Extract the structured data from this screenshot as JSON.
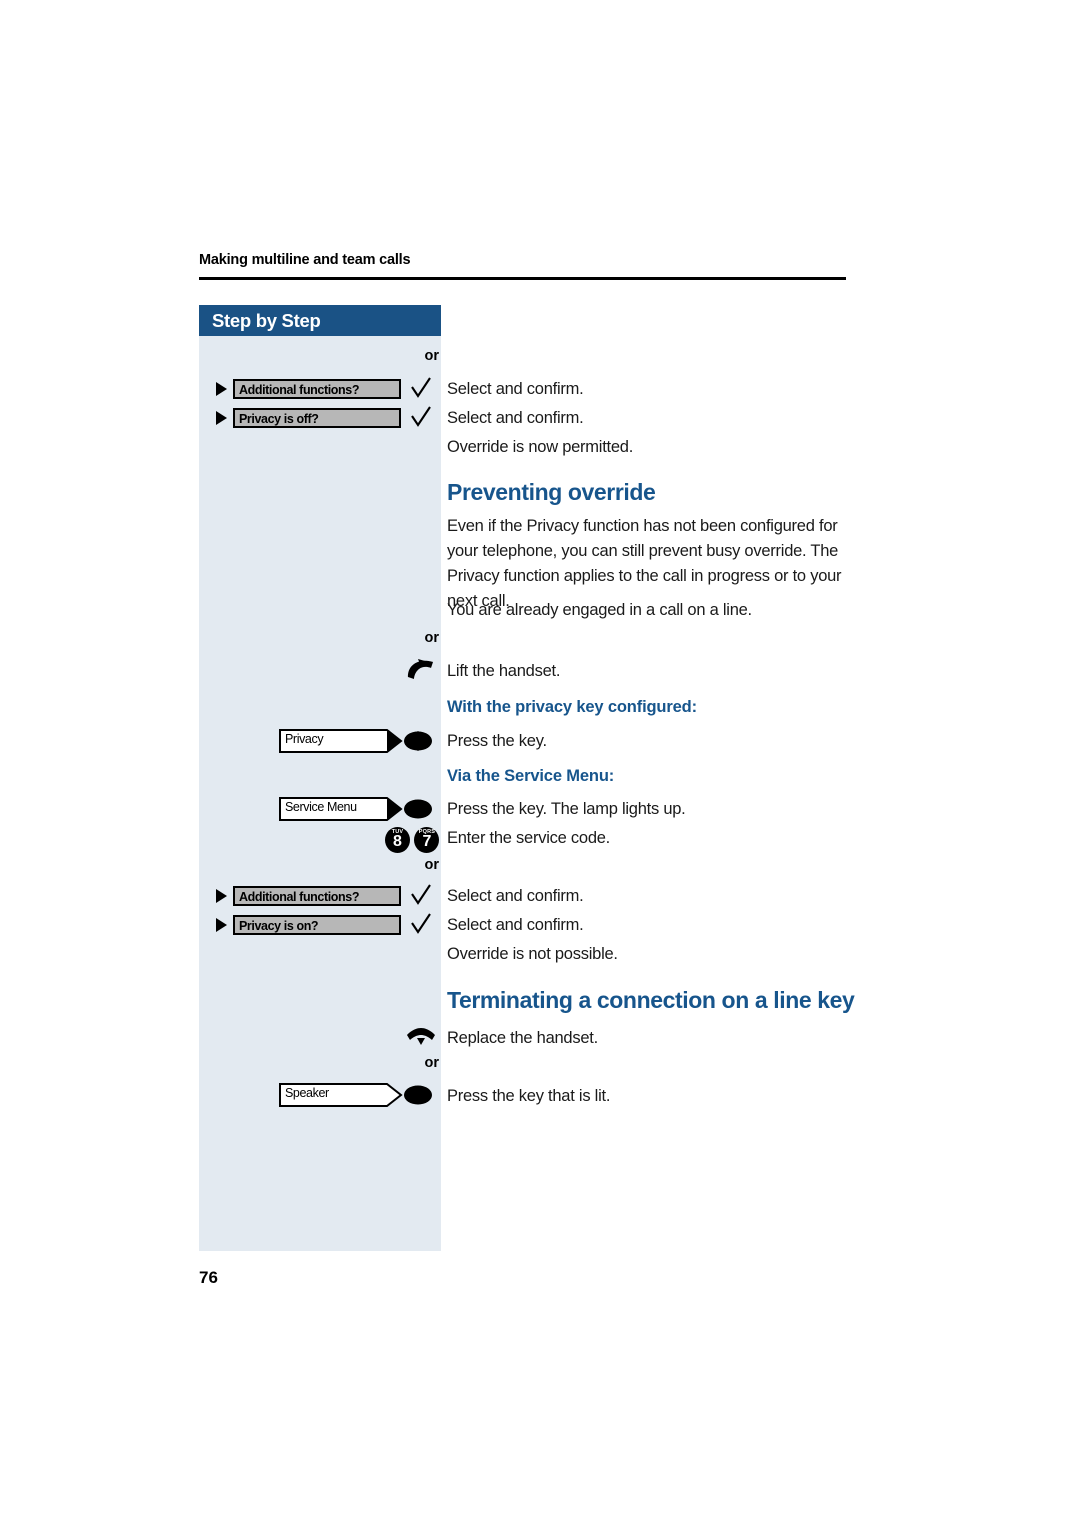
{
  "page": {
    "running_header": "Making multiline and team calls",
    "folio": "76",
    "sidebar_title": "Step by Step",
    "accent_color": "#1a5285",
    "heading_color": "#17558c",
    "sidebar_bg": "#e3eaf1"
  },
  "or_labels": {
    "first": "or",
    "second": "or",
    "third": "or",
    "fourth": "or"
  },
  "steps": {
    "additional_functions_off": "Additional functions?",
    "privacy_is_off": "Privacy is off?",
    "additional_functions_on": "Additional functions?",
    "privacy_is_on": "Privacy is on?",
    "privacy_key": "Privacy",
    "service_menu_key": "Service Menu",
    "speaker_key": "Speaker"
  },
  "dial_keys": [
    {
      "digit": "8",
      "letters": "TUV"
    },
    {
      "digit": "7",
      "letters": "PQRS"
    }
  ],
  "instructions": {
    "select_confirm_1": "Select and confirm.",
    "select_confirm_2": "Select and confirm.",
    "override_permitted": "Override is now permitted.",
    "lift_handset": "Lift the handset.",
    "press_the_key": "Press the key.",
    "press_key_lamp": "Press the key. The lamp lights up.",
    "enter_service_code": "Enter the service code.",
    "select_confirm_3": "Select and confirm.",
    "select_confirm_4": "Select and confirm.",
    "override_not_possible": "Override is not possible.",
    "replace_handset": "Replace the handset.",
    "press_key_lit": "Press the key that is lit."
  },
  "sections": {
    "preventing_override_title": "Preventing override",
    "preventing_override_body": "Even if the Privacy function has not been configured for your telephone, you can still prevent busy override. The Privacy function applies to the call in progress or to your next call.",
    "already_engaged": "You are already engaged in a call on a line.",
    "with_privacy_key": "With the privacy key configured:",
    "via_service_menu": "Via the Service Menu:",
    "terminating_title": "Terminating a connection on a line key"
  }
}
